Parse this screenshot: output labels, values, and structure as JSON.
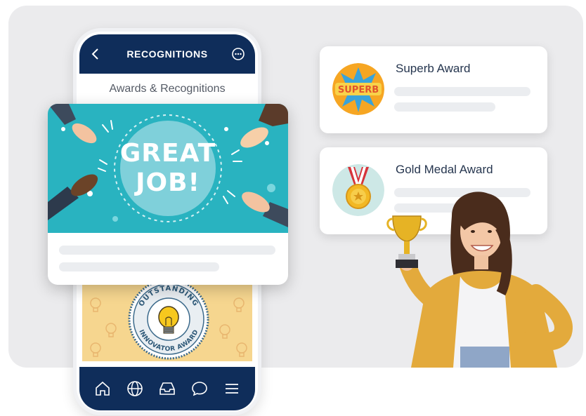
{
  "phone": {
    "title": "RECOGNITIONS",
    "subtitle": "Awards & Recognitions",
    "header_color": "#0f2d5a",
    "nav_items": [
      "home-icon",
      "globe-icon",
      "inbox-icon",
      "chat-icon",
      "menu-icon"
    ]
  },
  "greatjob_card": {
    "line1": "GREAT",
    "line2": "JOB!",
    "background_color": "#29b3c0"
  },
  "innovator_card": {
    "badge_top": "OUTSTANDING",
    "badge_bottom": "INNOVATOR AWARD"
  },
  "awards": [
    {
      "title": "Superb Award",
      "icon": "superb-badge-icon"
    },
    {
      "title": "Gold Medal Award",
      "icon": "gold-medal-icon"
    }
  ]
}
